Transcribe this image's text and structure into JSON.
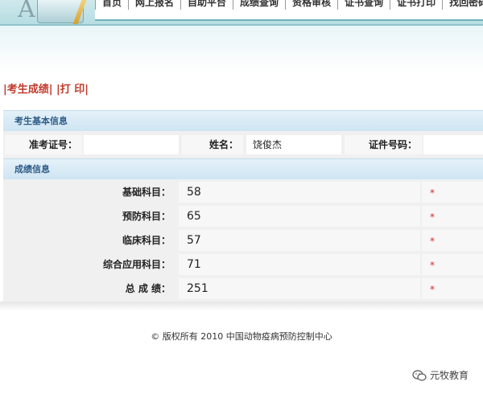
{
  "header": {
    "nav": [
      "首页",
      "网上报名",
      "自助平台",
      "成绩查询",
      "资格审核",
      "证书查询",
      "证书打印",
      "找回密码"
    ]
  },
  "toolbar": {
    "score_link": "|考生成绩|",
    "print_link": "|打 印|"
  },
  "basic_info": {
    "title": "考生基本信息",
    "ticket_label": "准考证号：",
    "ticket_value": "",
    "name_label": "姓名：",
    "name_value": "饶俊杰",
    "id_label": "证件号码：",
    "id_value": ""
  },
  "score_info": {
    "title": "成绩信息",
    "rows": [
      {
        "label": "基础科目：",
        "value": "58",
        "mark": "*"
      },
      {
        "label": "预防科目：",
        "value": "65",
        "mark": "*"
      },
      {
        "label": "临床科目：",
        "value": "57",
        "mark": "*"
      },
      {
        "label": "综合应用科目：",
        "value": "71",
        "mark": "*"
      },
      {
        "label": "总 成 绩：",
        "value": "251",
        "mark": "*"
      }
    ]
  },
  "footer": {
    "copyright": "© 版权所有 2010 中国动物疫病预防控制中心"
  },
  "watermark": {
    "text": "元牧教育"
  }
}
